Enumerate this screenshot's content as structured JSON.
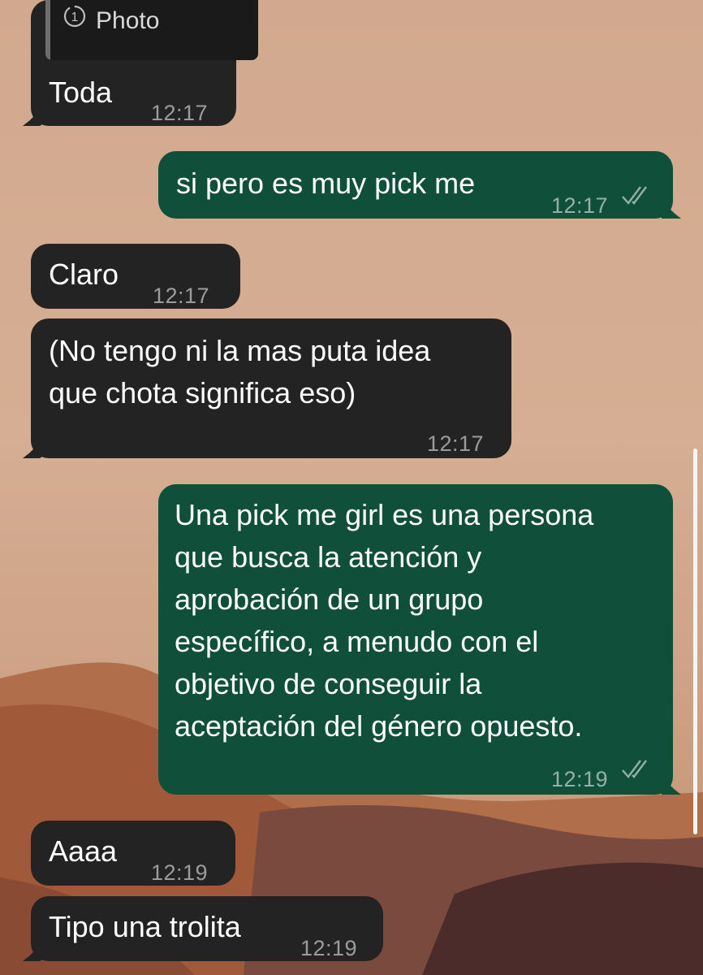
{
  "chat": {
    "messages": [
      {
        "text": "Toda",
        "time": "12:17",
        "reply_label": "Photo"
      },
      {
        "text": "si pero es muy pick me",
        "time": "12:17"
      },
      {
        "text": "Claro",
        "time": "12:17"
      },
      {
        "text": "(No tengo ni la mas puta idea\nque chota significa eso)",
        "time": "12:17"
      },
      {
        "text": "Una pick me girl es una persona\nque busca la atención y\naprobación de un grupo\nespecífico, a menudo con el\nobjetivo de conseguir la\naceptación del género opuesto.",
        "time": "12:19"
      },
      {
        "text": "Aaaa",
        "time": "12:19"
      },
      {
        "text": "Tipo una trolita",
        "time": "12:19"
      }
    ]
  },
  "colors": {
    "incoming_bubble": "#232323",
    "outgoing_bubble": "#10503a",
    "wallpaper": "#d2a98e"
  },
  "icons": {
    "photo_reply": "view-once-icon",
    "read_receipt": "double-check-icon"
  }
}
